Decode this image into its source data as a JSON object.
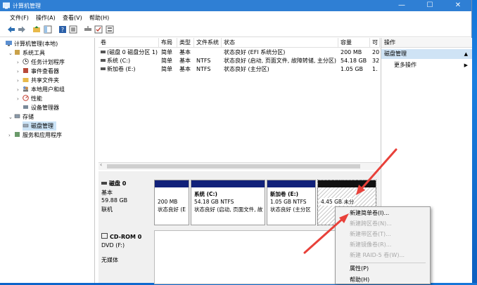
{
  "window": {
    "title": "计算机管理",
    "controls": [
      "—",
      "☐",
      "✕"
    ]
  },
  "menu": [
    "文件(F)",
    "操作(A)",
    "查看(V)",
    "帮助(H)"
  ],
  "tree": {
    "root": "计算机管理(本地)",
    "system_tools": "系统工具",
    "task_scheduler": "任务计划程序",
    "event_viewer": "事件查看器",
    "shared_folders": "共享文件夹",
    "local_users": "本地用户和组",
    "performance": "性能",
    "device_manager": "设备管理器",
    "storage": "存储",
    "disk_management": "磁盘管理",
    "services_apps": "服务和应用程序"
  },
  "volume_table": {
    "headers": [
      "卷",
      "布局",
      "类型",
      "文件系统",
      "状态",
      "容量",
      "可"
    ],
    "rows": [
      [
        "(磁盘 0 磁盘分区 1)",
        "简单",
        "基本",
        "",
        "状态良好 (EFI 系统分区)",
        "200 MB",
        "20"
      ],
      [
        "系统 (C:)",
        "简单",
        "基本",
        "NTFS",
        "状态良好 (启动, 页面文件, 故障转储, 主分区)",
        "54.18 GB",
        "32"
      ],
      [
        "新加卷 (E:)",
        "简单",
        "基本",
        "NTFS",
        "状态良好 (主分区)",
        "1.05 GB",
        "1."
      ]
    ]
  },
  "disk0": {
    "name": "磁盘 0",
    "type": "基本",
    "size": "59.88 GB",
    "status": "联机",
    "partitions": [
      {
        "title": "",
        "size": "200 MB",
        "status": "状态良好 (E"
      },
      {
        "title": "系统 (C:)",
        "size": "54.18 GB NTFS",
        "status": "状态良好 (启动, 页面文件, 故"
      },
      {
        "title": "新加卷 (E:)",
        "size": "1.05 GB NTFS",
        "status": "状态良好 (主分区"
      },
      {
        "title": "",
        "size": "4.45 GB",
        "status": "未分"
      }
    ]
  },
  "cdrom": {
    "name": "CD-ROM 0",
    "drive": "DVD (F:)",
    "status": "无媒体"
  },
  "actions": {
    "header": "操作",
    "section": "磁盘管理",
    "more": "更多操作"
  },
  "context_menu": {
    "items": [
      {
        "label": "新建简单卷(I)...",
        "enabled": true
      },
      {
        "label": "新建跨区卷(N)...",
        "enabled": false
      },
      {
        "label": "新建带区卷(T)...",
        "enabled": false
      },
      {
        "label": "新建镜像卷(R)...",
        "enabled": false
      },
      {
        "label": "新建 RAID-5 卷(W)...",
        "enabled": false
      },
      {
        "label": "属性(P)",
        "enabled": true
      },
      {
        "label": "帮助(H)",
        "enabled": true
      }
    ]
  },
  "colors": {
    "titlebar": "#2f7fd4",
    "partition_bar": "#11217a",
    "selection": "#cce4f7",
    "annotation_arrow": "#e8413a"
  }
}
